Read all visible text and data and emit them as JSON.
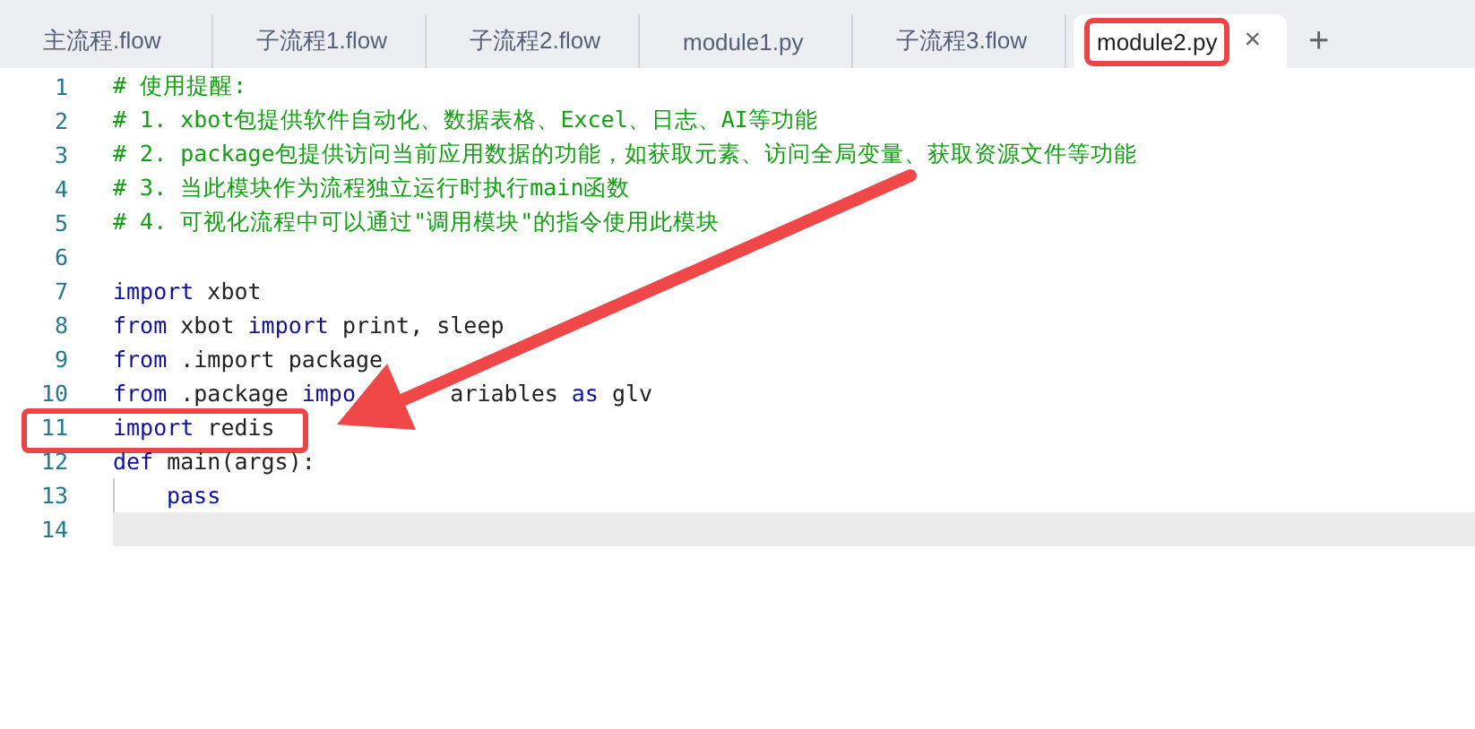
{
  "tabs": [
    {
      "label": "主流程.flow",
      "selected": false,
      "highlighted": false
    },
    {
      "label": "子流程1.flow",
      "selected": false,
      "highlighted": false
    },
    {
      "label": "子流程2.flow",
      "selected": false,
      "highlighted": false
    },
    {
      "label": "module1.py",
      "selected": false,
      "highlighted": false
    },
    {
      "label": "子流程3.flow",
      "selected": false,
      "highlighted": false
    },
    {
      "label": "module2.py",
      "selected": true,
      "highlighted": true
    }
  ],
  "close_label": "×",
  "add_label": "+",
  "lines": [
    {
      "number": "1",
      "current": false,
      "highlighted": false,
      "tokens": [
        {
          "text": "# 使用提醒:",
          "kind": "comment"
        }
      ]
    },
    {
      "number": "2",
      "current": false,
      "highlighted": false,
      "tokens": [
        {
          "text": "# 1. xbot包提供软件自动化、数据表格、Excel、日志、AI等功能",
          "kind": "comment"
        }
      ]
    },
    {
      "number": "3",
      "current": false,
      "highlighted": false,
      "tokens": [
        {
          "text": "# 2. package包提供访问当前应用数据的功能，如获取元素、访问全局变量、获取资源文件等功能",
          "kind": "comment"
        }
      ]
    },
    {
      "number": "4",
      "current": false,
      "highlighted": false,
      "tokens": [
        {
          "text": "# 3. 当此模块作为流程独立运行时执行main函数",
          "kind": "comment"
        }
      ]
    },
    {
      "number": "5",
      "current": false,
      "highlighted": false,
      "tokens": [
        {
          "text": "# 4. 可视化流程中可以通过\"调用模块\"的指令使用此模块",
          "kind": "comment"
        }
      ]
    },
    {
      "number": "6",
      "current": false,
      "highlighted": false
    },
    {
      "number": "7",
      "current": false,
      "highlighted": false,
      "tokens": [
        {
          "text": "import",
          "kind": "keyword"
        },
        {
          "text": " xbot",
          "kind": "plain"
        }
      ]
    },
    {
      "number": "8",
      "current": false,
      "highlighted": false,
      "tokens": [
        {
          "text": "from",
          "kind": "keyword"
        },
        {
          "text": " xbot ",
          "kind": "plain"
        },
        {
          "text": "import",
          "kind": "keyword"
        },
        {
          "text": " print, sleep",
          "kind": "plain"
        }
      ]
    },
    {
      "number": "9",
      "current": false,
      "highlighted": false,
      "tokens": [
        {
          "text": "from",
          "kind": "keyword"
        },
        {
          "text": " .import package",
          "kind": "plain"
        }
      ]
    },
    {
      "number": "10",
      "current": false,
      "highlighted": false,
      "tokens": [
        {
          "text": "from",
          "kind": "keyword"
        },
        {
          "text": " .package ",
          "kind": "plain"
        },
        {
          "text": "impo",
          "kind": "keyword"
        },
        {
          "text": "       ariables ",
          "kind": "plain"
        },
        {
          "text": "as",
          "kind": "keyword"
        },
        {
          "text": " glv",
          "kind": "plain"
        }
      ]
    },
    {
      "number": "11",
      "current": false,
      "highlighted": true,
      "tokens": [
        {
          "text": "import",
          "kind": "keyword"
        },
        {
          "text": " redis",
          "kind": "plain"
        }
      ]
    },
    {
      "number": "12",
      "current": false,
      "highlighted": false,
      "tokens": [
        {
          "text": "def",
          "kind": "keyword"
        },
        {
          "text": " main(args):",
          "kind": "plain"
        }
      ]
    },
    {
      "number": "13",
      "current": false,
      "highlighted": false,
      "indent": true,
      "tokens": [
        {
          "text": "pass",
          "kind": "keyword"
        }
      ]
    },
    {
      "number": "14",
      "current": true,
      "highlighted": false
    }
  ]
}
